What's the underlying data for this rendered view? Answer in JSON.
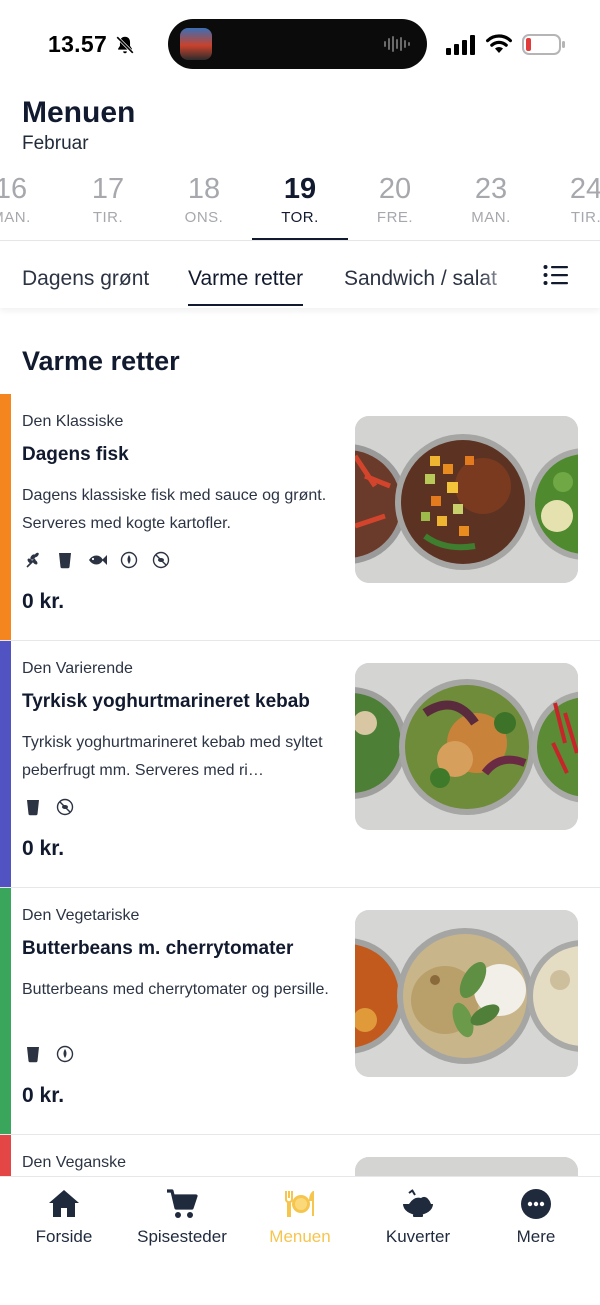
{
  "status_bar": {
    "time": "13.57"
  },
  "header": {
    "title": "Menuen",
    "month": "Februar"
  },
  "dates": [
    {
      "num": "16",
      "day": "MAN."
    },
    {
      "num": "17",
      "day": "TIR."
    },
    {
      "num": "18",
      "day": "ONS."
    },
    {
      "num": "19",
      "day": "TOR."
    },
    {
      "num": "20",
      "day": "FRE."
    },
    {
      "num": "23",
      "day": "MAN."
    },
    {
      "num": "24",
      "day": "TIR."
    }
  ],
  "selected_date": "19",
  "category_tabs": [
    "Dagens grønt",
    "Varme retter",
    "Sandwich / salat"
  ],
  "active_tab": "Varme retter",
  "section": {
    "title": "Varme retter"
  },
  "dishes": [
    {
      "category": "Den Klassiske",
      "name": "Dagens fisk",
      "description": "Dagens klassiske fisk med sauce og grønt. Serveres med kogte kartofler.",
      "price": "0 kr.",
      "color": "#f5861f",
      "icons": [
        "gluten-icon",
        "lactose-icon",
        "fish-icon",
        "allergen-icon",
        "no-pork-icon"
      ]
    },
    {
      "category": "Den Varierende",
      "name": "Tyrkisk yoghurtmarineret kebab",
      "description": "Tyrkisk yoghurtmarineret kebab med syltet peberfrugt mm. Serveres med ri…",
      "price": "0 kr.",
      "color": "#5253c2",
      "icons": [
        "lactose-icon",
        "no-pork-icon"
      ]
    },
    {
      "category": "Den Vegetariske",
      "name": "Butterbeans m. cherrytomater",
      "description": "Butterbeans med cherrytomater og persille.",
      "price": "0 kr.",
      "color": "#3aa65b",
      "icons": [
        "lactose-icon",
        "allergen-icon"
      ]
    },
    {
      "category": "Den Veganske",
      "color": "#e44545"
    }
  ],
  "bottom_nav": [
    {
      "label": "Forside",
      "icon": "home-icon"
    },
    {
      "label": "Spisesteder",
      "icon": "cart-icon"
    },
    {
      "label": "Menuen",
      "icon": "plate-cutlery-icon"
    },
    {
      "label": "Kuverter",
      "icon": "dish-bowl-icon"
    },
    {
      "label": "Mere",
      "icon": "more-icon"
    }
  ],
  "active_nav": "Menuen",
  "colors": {
    "accent": "#f6c54e",
    "text_dark": "#111a2e",
    "muted": "#a6a8ad"
  }
}
